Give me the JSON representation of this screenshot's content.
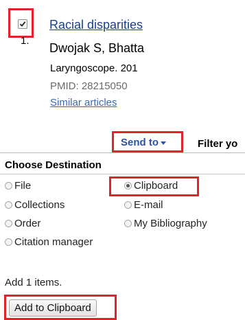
{
  "result": {
    "checked": true,
    "number": "1.",
    "title": "Racial disparities",
    "authors": "Dwojak S, Bhatta",
    "journal": "Laryngoscope. 201",
    "pmid": "PMID: 28215050",
    "similar_link": "Similar articles"
  },
  "toolbar": {
    "send_to_label": "Send to",
    "filter_label": "Filter yo"
  },
  "send_to_panel": {
    "header": "Choose Destination",
    "options": [
      {
        "label": "File",
        "selected": false
      },
      {
        "label": "Clipboard",
        "selected": true
      },
      {
        "label": "Collections",
        "selected": false
      },
      {
        "label": "E-mail",
        "selected": false
      },
      {
        "label": "Order",
        "selected": false
      },
      {
        "label": "My Bibliography",
        "selected": false
      },
      {
        "label": "Citation manager",
        "selected": false
      }
    ],
    "add_count_text": "Add 1 items.",
    "add_button_label": "Add to Clipboard"
  },
  "colors": {
    "highlight": "#e0242c",
    "link": "#1a3f8b",
    "send_to": "#2a52a6"
  }
}
